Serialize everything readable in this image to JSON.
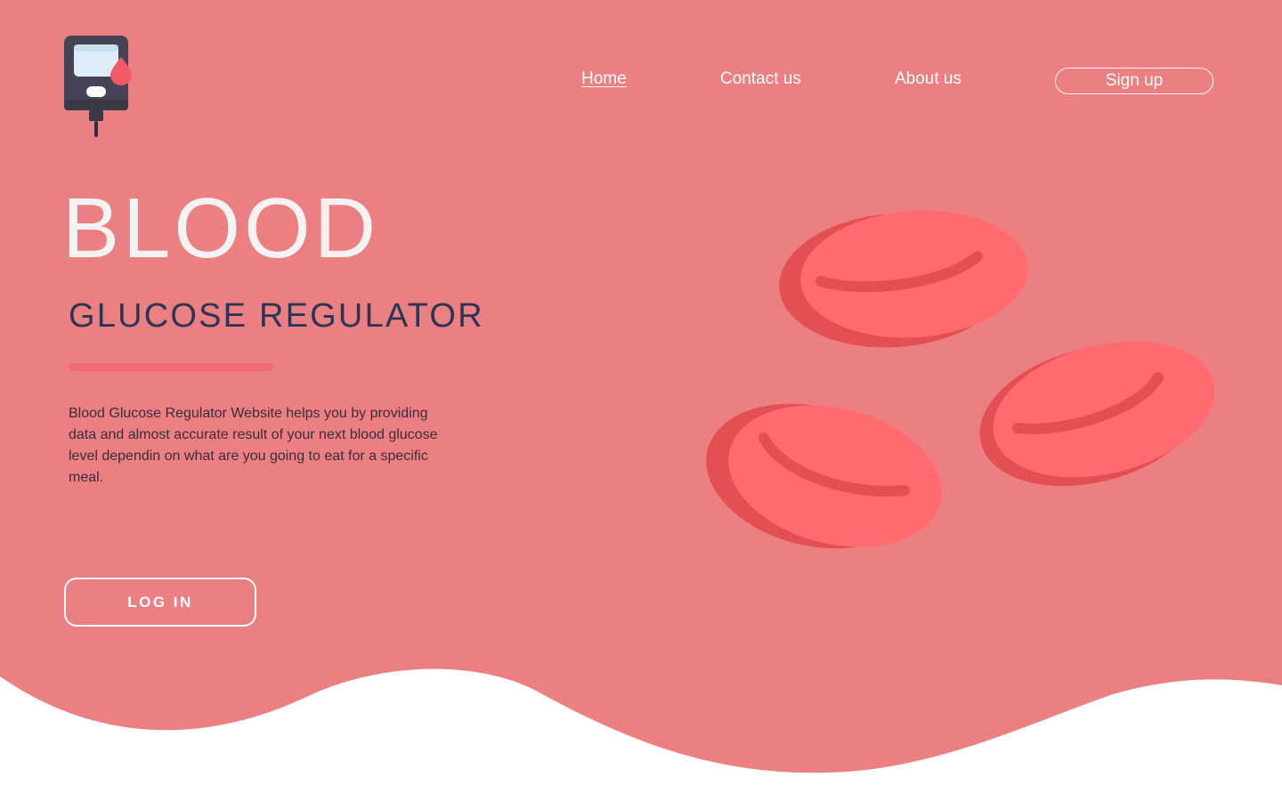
{
  "nav": {
    "home": "Home",
    "contact": "Contact us",
    "about": "About us",
    "signup": "Sign up"
  },
  "hero": {
    "title": "BLOOD",
    "subtitle": "GLUCOSE REGULATOR",
    "description": "Blood Glucose Regulator Website helps you by providing data and almost accurate result of your next blood glucose level dependin on what are you going to eat for a specific meal.",
    "login_label": "LOG IN"
  },
  "icons": {
    "logo": "glucose-meter-icon",
    "illustration": "red-blood-cells-illustration"
  },
  "colors": {
    "background": "#ec7f82",
    "accent": "#f06b6f",
    "cell": "#ff6b6f",
    "cell_shadow": "#e34f52",
    "subtitle": "#2b3556"
  }
}
